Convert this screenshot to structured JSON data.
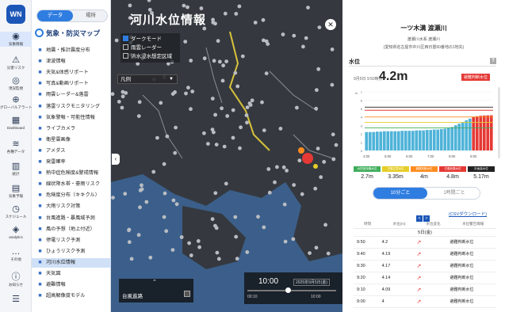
{
  "app": {
    "logo": "WN"
  },
  "rail": [
    {
      "label": "気象情報",
      "icon": "person-icon"
    },
    {
      "label": "災害リスク",
      "icon": "alert-icon"
    },
    {
      "label": "現況監視",
      "icon": "monitor-icon"
    },
    {
      "label": "グローバルアラート",
      "icon": "globe-icon"
    },
    {
      "label": "Dashboard",
      "icon": "dashboard-icon"
    },
    {
      "label": "各種データ",
      "icon": "database-icon"
    },
    {
      "label": "統計",
      "icon": "stats-icon"
    },
    {
      "label": "気象予報",
      "icon": "calendar-icon"
    },
    {
      "label": "スケジュール",
      "icon": "schedule-icon"
    },
    {
      "label": "analytics",
      "icon": "analytics-icon"
    },
    {
      "label": "その他",
      "icon": "more-icon"
    },
    {
      "label": "お知らせ",
      "icon": "info-icon"
    },
    {
      "label": "",
      "icon": "user-icon"
    }
  ],
  "menu": {
    "toggle": {
      "left": "データ",
      "right": "場所"
    },
    "section": "気象・防災マップ",
    "items": [
      {
        "label": "地震・推計震度分布",
        "icon": "quake-icon"
      },
      {
        "label": "津波情報",
        "icon": "tsunami-icon"
      },
      {
        "label": "天気&体感リポート",
        "icon": "weather-report-icon"
      },
      {
        "label": "写真&動画リポート",
        "icon": "camera-icon"
      },
      {
        "label": "雨雲レーダー&落雷",
        "icon": "radar-icon"
      },
      {
        "label": "落雷リスクモニタリング",
        "icon": "lightning-icon"
      },
      {
        "label": "気象警報・可能性情報",
        "icon": "warning-icon"
      },
      {
        "label": "ライブカメラ",
        "icon": "live-camera-icon"
      },
      {
        "label": "衛星雲画像",
        "icon": "satellite-icon"
      },
      {
        "label": "アメダス",
        "icon": "amedas-icon"
      },
      {
        "label": "発雷確率",
        "icon": "thunder-icon"
      },
      {
        "label": "熱中症危険度&警戒情報",
        "icon": "heat-icon"
      },
      {
        "label": "線状降水帯・豪雨リスク",
        "icon": "heavy-rain-icon"
      },
      {
        "label": "危険度分布（キキクル）",
        "icon": "risk-map-icon"
      },
      {
        "label": "大雨リスク対策",
        "icon": "umbrella-icon"
      },
      {
        "label": "台風進路・暴風域予測",
        "icon": "typhoon-icon"
      },
      {
        "label": "風の予想（地上付近）",
        "icon": "wind-icon"
      },
      {
        "label": "停電リスク予測",
        "icon": "power-icon"
      },
      {
        "label": "ひょうリスク予測",
        "icon": "hail-icon"
      },
      {
        "label": "河川水位情報",
        "icon": "river-icon"
      },
      {
        "label": "天気図",
        "icon": "weather-map-icon"
      },
      {
        "label": "避難情報",
        "icon": "evacuation-icon"
      },
      {
        "label": "超高解像度モデル",
        "icon": "model-icon"
      }
    ],
    "active_index": 19
  },
  "map": {
    "title": "河川水位情報",
    "layers": [
      {
        "label": "ダークモード",
        "checked": true
      },
      {
        "label": "雨雲レーダー",
        "checked": false
      },
      {
        "label": "洪水浸水想定区域",
        "checked": false
      }
    ],
    "legend_select": "凡例",
    "bottom_panel_label": "台風進路",
    "time": "10:00",
    "date": "2025年9月5日(金)",
    "slider_start": "00:10",
    "slider_end": "10:00"
  },
  "detail": {
    "title": "一ツ木溝 渡瀬川",
    "sub1": "渡瀬川水系 渡瀬川",
    "sub2": "(愛知県名古屋市中川区西日置60番地の1地先)",
    "section_label": "水位",
    "help": "?",
    "time": "9月5日 9:50時点",
    "level": "4.2m",
    "badge": "避難判断水位",
    "thresholds": [
      {
        "label": "水防団待機水位",
        "value": "2.7m",
        "color": "#3fae5a"
      },
      {
        "label": "氾濫注意水位",
        "value": "3.35m",
        "color": "#e6cd27"
      },
      {
        "label": "避難判断水位",
        "value": "4m",
        "color": "#ff8b1f"
      },
      {
        "label": "氾濫危険水位",
        "value": "4.8m",
        "color": "#e53935"
      },
      {
        "label": "計画高水位",
        "value": "5.17m",
        "color": "#222222"
      }
    ],
    "interval": {
      "a": "10分ごと",
      "b": "1時間ごと"
    },
    "pager": {
      "prev": "<",
      "next": ">"
    },
    "csv": "(CSVダウンロード)",
    "table_headers": [
      "時刻",
      "水位(m)",
      "水位変化",
      "水位警告情報"
    ],
    "table_unit": "5日(金)",
    "rows": [
      {
        "time": "9:50",
        "level": "4.2",
        "change": "↗",
        "status": "避難判断水位"
      },
      {
        "time": "9:40",
        "level": "4.19",
        "change": "↗",
        "status": "避難判断水位"
      },
      {
        "time": "9:30",
        "level": "4.17",
        "change": "↗",
        "status": "避難判断水位"
      },
      {
        "time": "9:20",
        "level": "4.14",
        "change": "↗",
        "status": "避難判断水位"
      },
      {
        "time": "9:10",
        "level": "4.09",
        "change": "↗",
        "status": "避難判断水位"
      },
      {
        "time": "9:00",
        "level": "4",
        "change": "↗",
        "status": "避難判断水位"
      }
    ]
  },
  "chart_data": {
    "type": "bar",
    "xlabel": "",
    "ylabel": "m",
    "ylim": [
      0,
      7
    ],
    "yticks": [
      0,
      1,
      2,
      3,
      4,
      5,
      6,
      7
    ],
    "xticks": [
      "4:00",
      "5:00",
      "6:00",
      "7:00",
      "8:00",
      "9:00"
    ],
    "categories": [
      "4:00",
      "4:10",
      "4:20",
      "4:30",
      "4:40",
      "4:50",
      "5:00",
      "5:10",
      "5:20",
      "5:30",
      "5:40",
      "5:50",
      "6:00",
      "6:10",
      "6:20",
      "6:30",
      "6:40",
      "6:50",
      "7:00",
      "7:10",
      "7:20",
      "7:30",
      "7:40",
      "7:50",
      "8:00",
      "8:10",
      "8:20",
      "8:30",
      "8:40",
      "8:50",
      "9:00",
      "9:10",
      "9:20",
      "9:30",
      "9:40",
      "9:50"
    ],
    "values": [
      2.2,
      2.2,
      2.2,
      2.25,
      2.25,
      2.3,
      2.3,
      2.3,
      2.3,
      2.3,
      2.35,
      2.35,
      2.35,
      2.35,
      2.4,
      2.4,
      2.4,
      2.45,
      2.45,
      2.5,
      2.5,
      2.55,
      2.6,
      2.7,
      2.8,
      3.0,
      3.2,
      3.4,
      3.6,
      3.8,
      4.0,
      4.09,
      4.14,
      4.17,
      4.19,
      4.2
    ],
    "threshold_lines": [
      {
        "name": "水防団待機水位",
        "value": 2.7,
        "color": "#3fae5a"
      },
      {
        "name": "氾濫注意水位",
        "value": 3.35,
        "color": "#e6cd27"
      },
      {
        "name": "避難判断水位",
        "value": 4.0,
        "color": "#ff8b1f"
      },
      {
        "name": "氾濫危険水位",
        "value": 4.8,
        "color": "#e53935"
      },
      {
        "name": "計画高水位",
        "value": 5.17,
        "color": "#222222"
      }
    ],
    "colors": {
      "below": "#4fb3d9",
      "above": "#e53935"
    }
  }
}
